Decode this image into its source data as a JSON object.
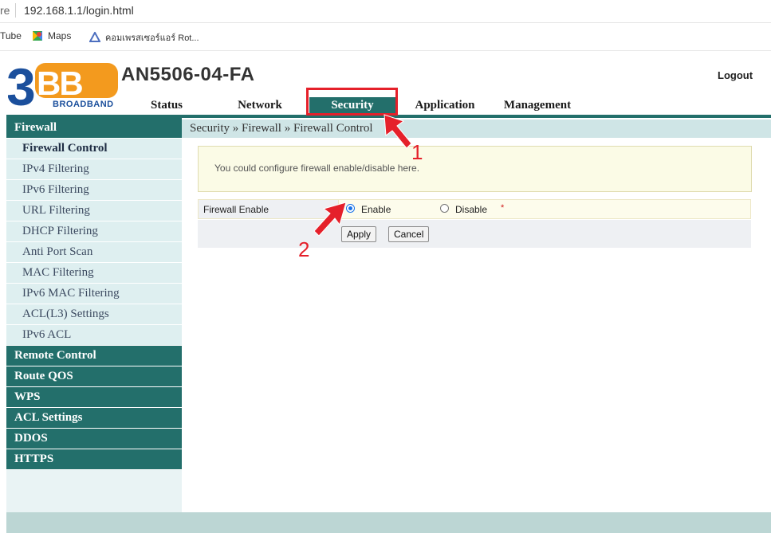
{
  "browser": {
    "security_text": "re",
    "url": "192.168.1.1/login.html",
    "bookmarks": [
      {
        "label": "Tube"
      },
      {
        "label": "Maps"
      },
      {
        "label": "คอมเพรสเซอร์แอร์ Rot..."
      }
    ]
  },
  "header": {
    "logo_main": "3BB",
    "logo_sub": "BROADBAND",
    "model": "AN5506-04-FA",
    "logout": "Logout",
    "tabs": [
      {
        "label": "Status"
      },
      {
        "label": "Network"
      },
      {
        "label": "Security",
        "active": true
      },
      {
        "label": "Application"
      },
      {
        "label": "Management"
      }
    ]
  },
  "sidebar": {
    "groups": [
      {
        "label": "Firewall",
        "items": [
          {
            "label": "Firewall Control",
            "active": true
          },
          {
            "label": "IPv4 Filtering"
          },
          {
            "label": "IPv6 Filtering"
          },
          {
            "label": "URL Filtering"
          },
          {
            "label": "DHCP Filtering"
          },
          {
            "label": "Anti Port Scan"
          },
          {
            "label": "MAC Filtering"
          },
          {
            "label": "IPv6 MAC Filtering"
          },
          {
            "label": "ACL(L3) Settings"
          },
          {
            "label": "IPv6 ACL"
          }
        ]
      },
      {
        "label": "Remote Control"
      },
      {
        "label": "Route QOS"
      },
      {
        "label": "WPS"
      },
      {
        "label": "ACL Settings"
      },
      {
        "label": "DDOS"
      },
      {
        "label": "HTTPS"
      }
    ]
  },
  "main": {
    "breadcrumb": "Security » Firewall » Firewall Control",
    "info": "You could configure firewall enable/disable here.",
    "field_label": "Firewall Enable",
    "options": [
      {
        "label": "Enable",
        "selected": true
      },
      {
        "label": "Disable",
        "selected": false
      }
    ],
    "required_mark": "*",
    "apply": "Apply",
    "cancel": "Cancel"
  },
  "annotations": {
    "step1": "1",
    "step2": "2",
    "color": "#e5202a"
  },
  "colors": {
    "teal": "#236f6b",
    "sidebar_item_bg": "#deeff0",
    "breadcrumb_bg": "#cfe5e6",
    "logo_blue": "#1b4f9c",
    "logo_orange": "#f39a1e"
  }
}
